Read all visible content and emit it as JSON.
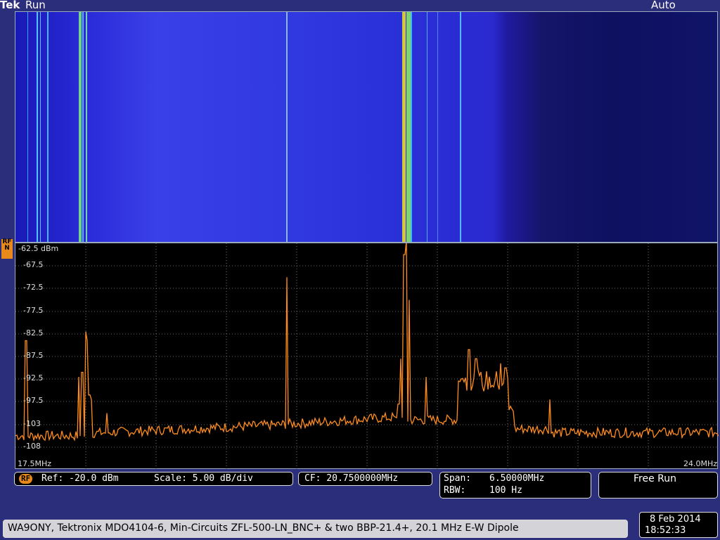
{
  "header": {
    "brand": "Tek",
    "status": "Run",
    "trigger_mode": "Auto"
  },
  "marker": {
    "label": "RF\nN"
  },
  "spectrum": {
    "ref_label": "-62.5 dBm",
    "y_ticks": [
      "-67.5",
      "-72.5",
      "-77.5",
      "-82.5",
      "-87.5",
      "-92.5",
      "-97.5",
      "-103",
      "-108"
    ],
    "start_freq": "17.5MHz",
    "stop_freq": "24.0MHz"
  },
  "readouts": {
    "rf_badge": "RF",
    "ref": "Ref: -20.0 dBm",
    "scale": "Scale: 5.00 dB/div",
    "cf": "CF: 20.7500000MHz",
    "span_label": "Span:",
    "span_value": "6.50000MHz",
    "rbw_label": "RBW:",
    "rbw_value": "100 Hz",
    "acq_mode": "Free Run"
  },
  "footer": {
    "note": "WA9ONY, Tektronix MDO4104-6, Min-Circuits ZFL-500-LN_BNC+ & two BBP-21.4+, 20.1 MHz E-W Dipole",
    "date": "8 Feb 2014",
    "time": "18:52:33"
  },
  "colors": {
    "trace": "#ff8c1a",
    "grid": "#7a7a7a",
    "waterfall_hot": "#f0e020"
  }
}
